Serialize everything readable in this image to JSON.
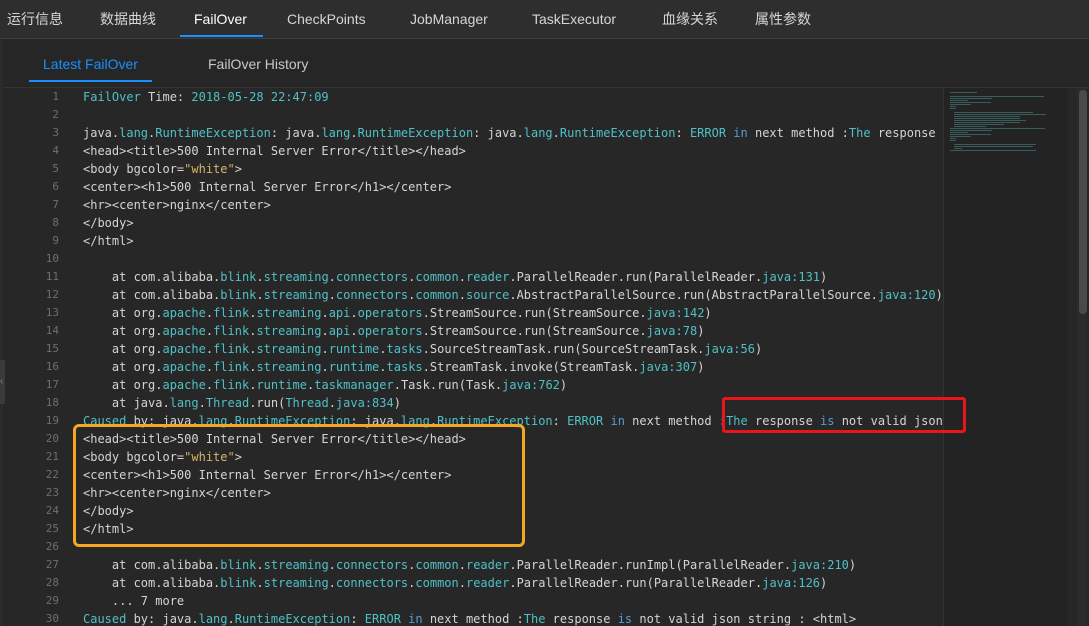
{
  "top_tabs": [
    {
      "label": "运行信息"
    },
    {
      "label": "数据曲线"
    },
    {
      "label": "FailOver"
    },
    {
      "label": "CheckPoints"
    },
    {
      "label": "JobManager"
    },
    {
      "label": "TaskExecutor"
    },
    {
      "label": "血缘关系"
    },
    {
      "label": "属性参数"
    }
  ],
  "active_top_tab": "FailOver",
  "sub_tabs": [
    {
      "label": "Latest FailOver"
    },
    {
      "label": "FailOver History"
    }
  ],
  "active_sub_tab": "Latest FailOver",
  "code_lines": [
    "FailOver Time: 2018-05-28 22:47:09",
    "",
    "java.lang.RuntimeException: java.lang.RuntimeException: java.lang.RuntimeException: ERROR in next method :The response",
    "<head><title>500 Internal Server Error</title></head>",
    "<body bgcolor=\"white\">",
    "<center><h1>500 Internal Server Error</h1></center>",
    "<hr><center>nginx</center>",
    "</body>",
    "</html>",
    "",
    "    at com.alibaba.blink.streaming.connectors.common.reader.ParallelReader.run(ParallelReader.java:131)",
    "    at com.alibaba.blink.streaming.connectors.common.source.AbstractParallelSource.run(AbstractParallelSource.java:120)",
    "    at org.apache.flink.streaming.api.operators.StreamSource.run(StreamSource.java:142)",
    "    at org.apache.flink.streaming.api.operators.StreamSource.run(StreamSource.java:78)",
    "    at org.apache.flink.streaming.runtime.tasks.SourceStreamTask.run(SourceStreamTask.java:56)",
    "    at org.apache.flink.streaming.runtime.tasks.StreamTask.invoke(StreamTask.java:307)",
    "    at org.apache.flink.runtime.taskmanager.Task.run(Task.java:762)",
    "    at java.lang.Thread.run(Thread.java:834)",
    "Caused by: java.lang.RuntimeException: java.lang.RuntimeException: ERROR in next method :The response is not valid json",
    "<head><title>500 Internal Server Error</title></head>",
    "<body bgcolor=\"white\">",
    "<center><h1>500 Internal Server Error</h1></center>",
    "<hr><center>nginx</center>",
    "</body>",
    "</html>",
    "",
    "    at com.alibaba.blink.streaming.connectors.common.reader.ParallelReader.runImpl(ParallelReader.java:210)",
    "    at com.alibaba.blink.streaming.connectors.common.reader.ParallelReader.run(ParallelReader.java:126)",
    "    ... 7 more",
    "Caused by: java.lang.RuntimeException: ERROR in next method :The response is not valid json string : <html>"
  ],
  "colors": {
    "accent": "#1890ff",
    "highlight_red": "#e8161a",
    "highlight_orange": "#f5a623",
    "token": "#4fc1c6",
    "string": "#d9b46a"
  }
}
